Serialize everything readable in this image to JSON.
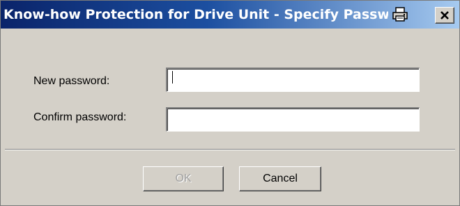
{
  "window": {
    "title": "Know-how Protection for Drive Unit - Specify Password"
  },
  "titlebar_buttons": {
    "print_icon": "printer-icon",
    "close_icon": "close-icon"
  },
  "form": {
    "new_password_label": "New password:",
    "new_password_value": "",
    "confirm_password_label": "Confirm password:",
    "confirm_password_value": ""
  },
  "buttons": {
    "ok_label": "OK",
    "ok_enabled": false,
    "cancel_label": "Cancel"
  },
  "colors": {
    "title_gradient_start": "#0a246a",
    "title_gradient_end": "#a6caf0",
    "dialog_face": "#d4d0c8",
    "disabled_text": "#a0a0a0"
  }
}
